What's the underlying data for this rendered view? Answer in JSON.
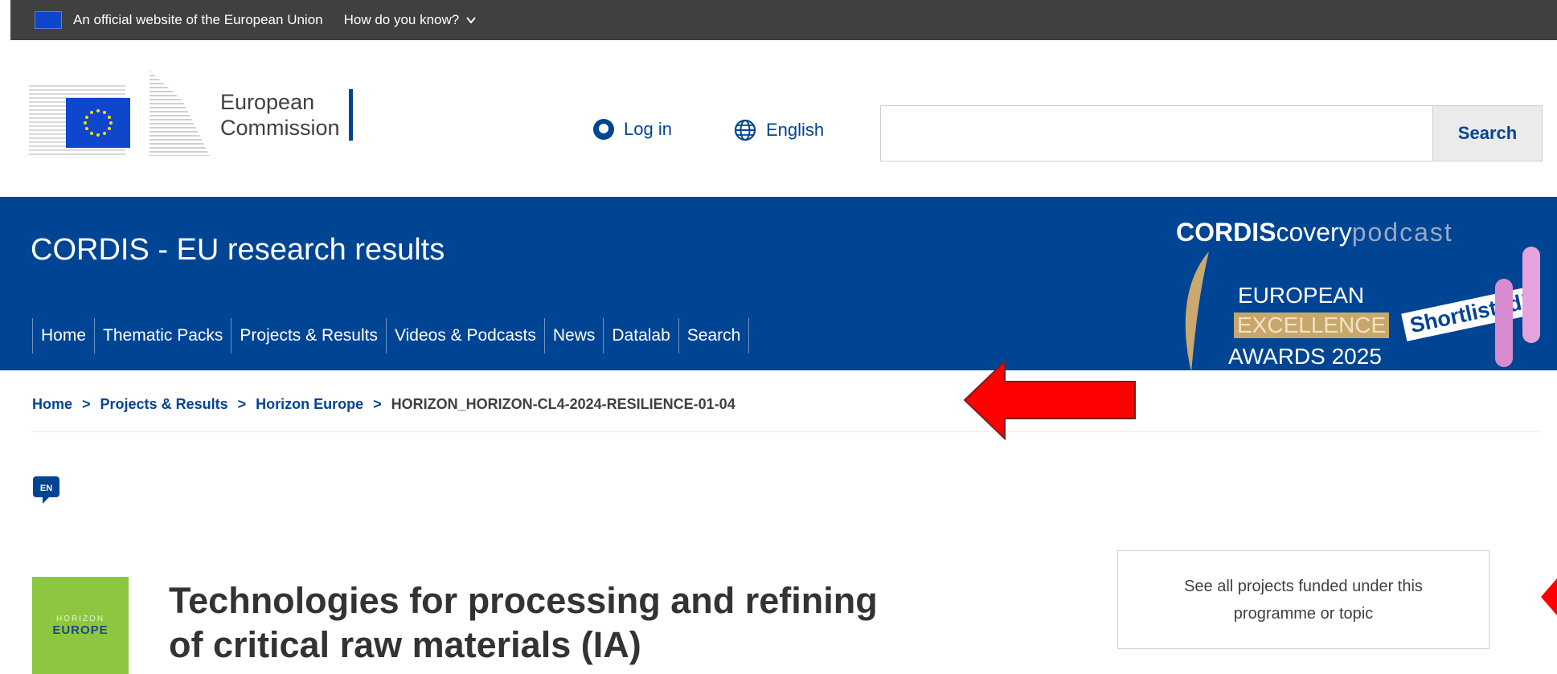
{
  "gov_bar": {
    "official_text": "An official website of the European Union",
    "how_know": "How do you know?"
  },
  "header": {
    "logo_line1": "European",
    "logo_line2": "Commission",
    "login": "Log in",
    "language": "English",
    "search_placeholder": "",
    "search_button": "Search"
  },
  "banner": {
    "site_name": "CORDIS - EU research results",
    "nav": [
      "Home",
      "Thematic Packs",
      "Projects & Results",
      "Videos & Podcasts",
      "News",
      "Datalab",
      "Search"
    ],
    "promo": {
      "brand_bold": "CORDIS",
      "brand_light": "covery",
      "brand_tail": "podcast",
      "award_line1": "EUROPEAN",
      "award_line2": "EXCELLENCE",
      "award_line3": "AWARDS 2025",
      "badge": "Shortlisted!"
    }
  },
  "breadcrumb": {
    "items": [
      "Home",
      "Projects & Results",
      "Horizon Europe"
    ],
    "current": "HORIZON_HORIZON-CL4-2024-RESILIENCE-01-04",
    "separator": ">"
  },
  "language_badge": "EN",
  "programme": {
    "logo_line1": "HORIZON",
    "logo_line2": "EUROPE",
    "title_line1": "Technologies for processing and refining",
    "title_line2": "of critical raw materials (IA)",
    "see_all": "See all projects funded under this programme or topic"
  },
  "colors": {
    "eu_blue": "#004494",
    "gov_bar": "#404040",
    "horizon_green": "#8dc63f",
    "annotation_arrow": "#ff0000"
  }
}
